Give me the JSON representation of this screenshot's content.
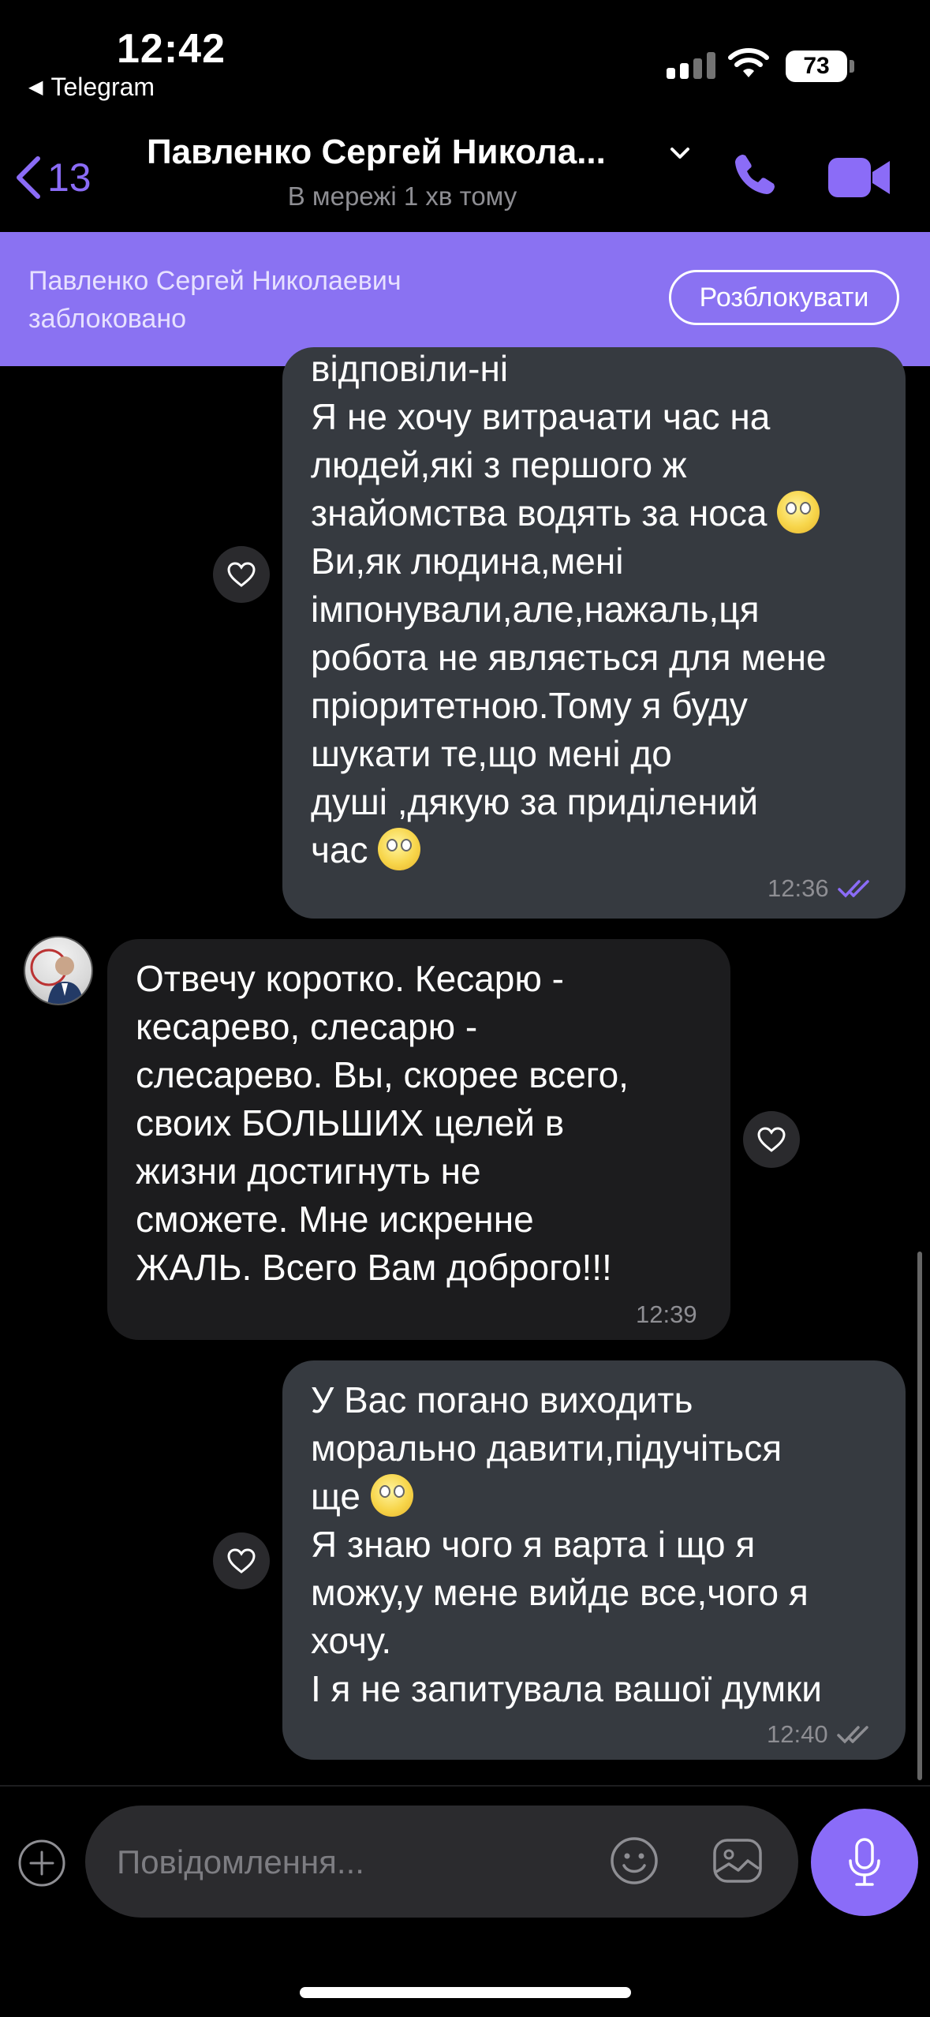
{
  "status_bar": {
    "time": "12:42",
    "back_app": "Telegram",
    "battery": "73"
  },
  "header": {
    "back_count": "13",
    "title": "Павленко Сергей Никола...",
    "presence": "В мережі 1 хв тому",
    "icons": [
      "chevron-left-icon",
      "chevron-down-icon",
      "phone-icon",
      "video-camera-icon"
    ]
  },
  "block_banner": {
    "text": "Павленко Сергей Николаевич заблоковано",
    "unblock_label": "Розблокувати"
  },
  "messages": [
    {
      "direction": "outgoing",
      "lines": [
        "відповіли-ні",
        "Я не хочу витрачати час на",
        "людей,які з першого ж",
        "знайомства водять за носа",
        "Ви,як людина,мені",
        "імпонували,але,нажаль,ця",
        "робота не являється для мене",
        "пріоритетною.Тому я буду",
        "шукати те,що мені до",
        "душі ,дякую за приділений",
        "час"
      ],
      "time": "12:36",
      "read": true
    },
    {
      "direction": "incoming",
      "lines": [
        "Отвечу коротко. Кесарю -",
        "кесарево, слесарю -",
        "слесарево. Вы, скорее всего,",
        "своих БОЛЬШИХ целей в",
        "жизни достигнуть не",
        "сможете. Мне искренне",
        "ЖАЛЬ. Всего Вам доброго!!!"
      ],
      "time": "12:39"
    },
    {
      "direction": "outgoing",
      "lines": [
        "У Вас погано виходить",
        "морально давити,підучіться",
        "ще",
        "Я знаю чого я варта і що я",
        "можу,у мене вийде все,чого я",
        "хочу.",
        "І я не запитувала вашої думки"
      ],
      "time": "12:40",
      "read": false
    }
  ],
  "composer": {
    "placeholder": "Повідомлення..."
  },
  "colors": {
    "accent": "#8a72f2",
    "outgoing_bubble": "#363a40",
    "incoming_bubble": "#1c1c1e"
  }
}
